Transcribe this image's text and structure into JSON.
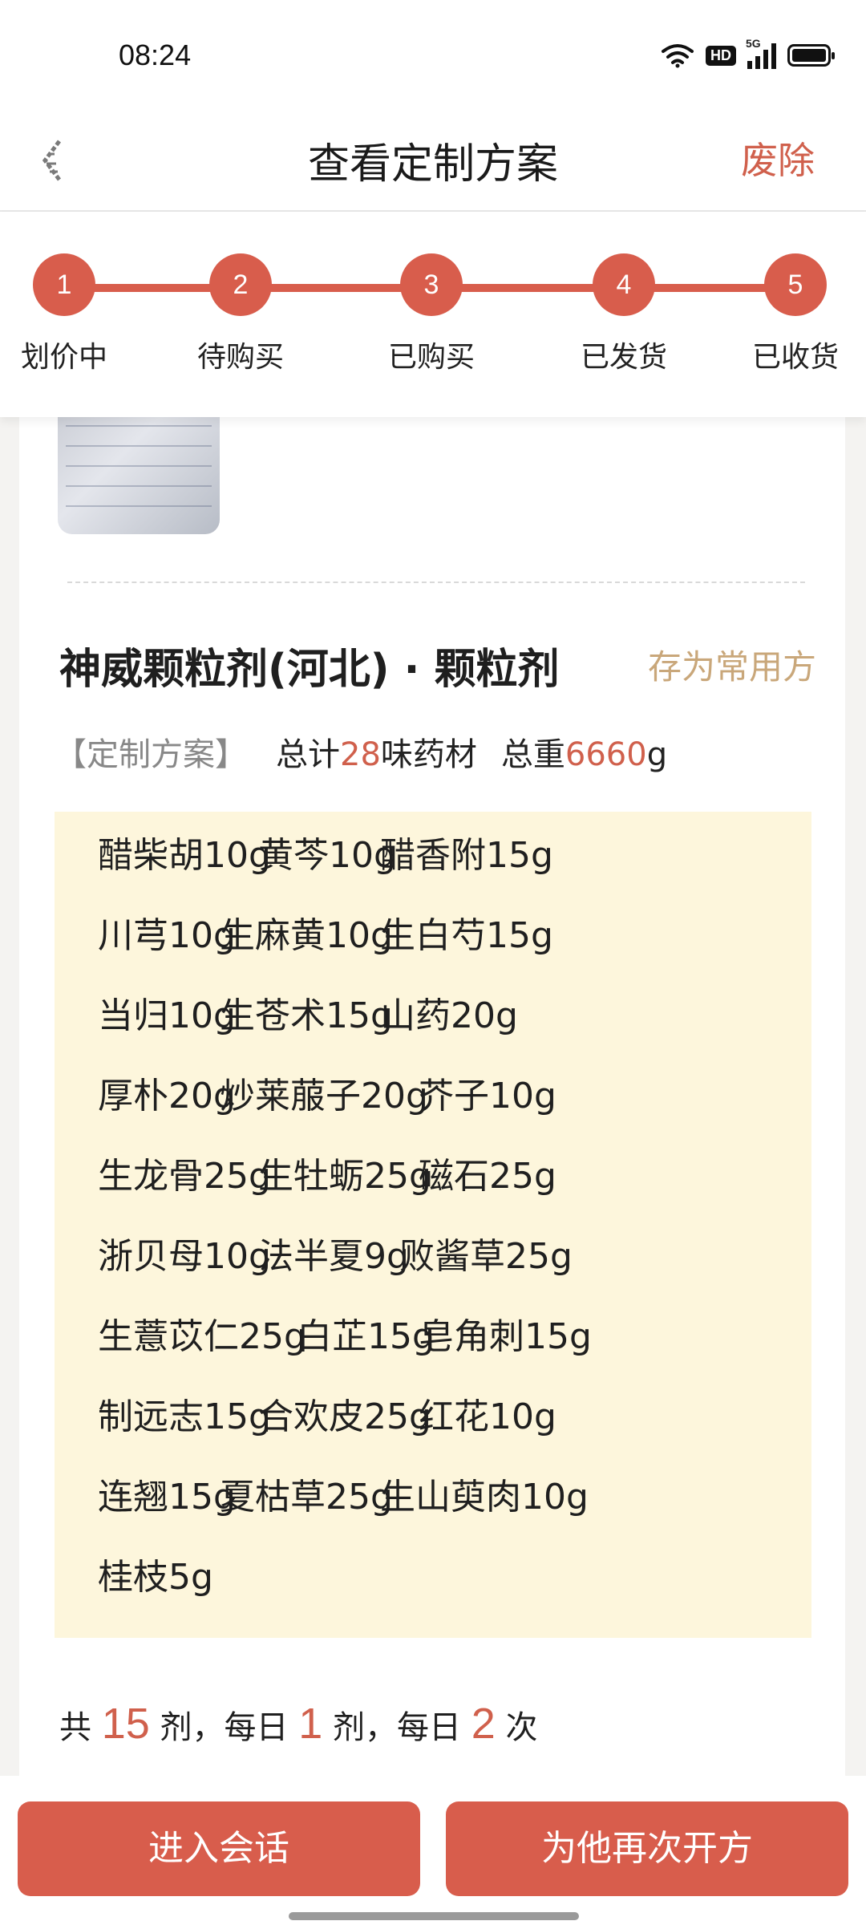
{
  "status_bar": {
    "time": "08:24",
    "hd": "HD",
    "network": "5G",
    "icons": [
      "wifi-icon",
      "hd-icon",
      "signal-5g-icon",
      "battery-icon"
    ]
  },
  "nav": {
    "title": "查看定制方案",
    "action": "废除",
    "back_icon": "back-arrow-icon"
  },
  "steps": [
    {
      "num": "1",
      "label": "划价中"
    },
    {
      "num": "2",
      "label": "待购买"
    },
    {
      "num": "3",
      "label": "已购买"
    },
    {
      "num": "4",
      "label": "已发货"
    },
    {
      "num": "5",
      "label": "已收货"
    }
  ],
  "prescription": {
    "title": "神威颗粒剂(河北) · 颗粒剂",
    "save_label": "存为常用方",
    "tag": "【定制方案】",
    "total_prefix": "总计",
    "total_count": "28",
    "total_suffix": "味药材",
    "weight_prefix": "总重",
    "weight_value": "6660",
    "weight_unit": "g",
    "herbs": [
      [
        "醋柴胡10g",
        "黄芩10g",
        "醋香附15g"
      ],
      [
        "川芎10g",
        "生麻黄10g",
        "生白芍15g"
      ],
      [
        "当归10g",
        "生苍术15g",
        "山药20g"
      ],
      [
        "厚朴20g",
        "炒莱菔子20g",
        "芥子10g"
      ],
      [
        "生龙骨25g",
        "生牡蛎25g",
        "磁石25g"
      ],
      [
        "浙贝母10g",
        "法半夏9g",
        "败酱草25g"
      ],
      [
        "生薏苡仁25g",
        "白芷15g",
        "皂角刺15g"
      ],
      [
        "制远志15g",
        "合欢皮25g",
        "红花10g"
      ],
      [
        "连翘15g",
        "夏枯草25g",
        "生山萸肉10g"
      ],
      [
        "桂枝5g"
      ]
    ],
    "dosage": {
      "p1": "共",
      "doses": "15",
      "p2": "剂，每日",
      "per_day": "1",
      "p3": "剂，每日",
      "times": "2",
      "p4": "次"
    }
  },
  "buttons": {
    "chat": "进入会话",
    "represcribe": "为他再次开方"
  },
  "colors": {
    "accent": "#d85d4c",
    "gold": "#c9a77a",
    "herb_bg": "#fdf6dc"
  }
}
